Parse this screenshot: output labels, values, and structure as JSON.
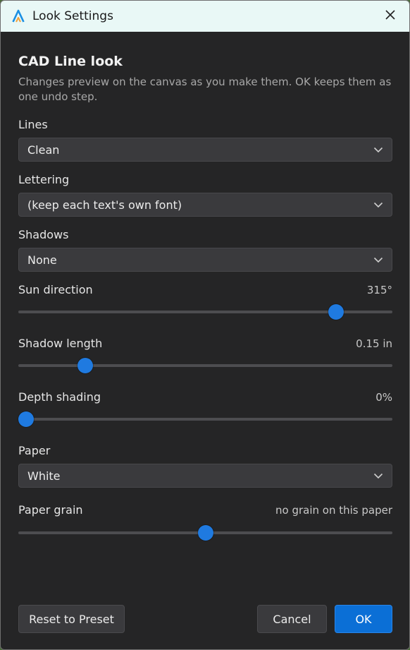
{
  "window": {
    "title": "Look Settings",
    "icons": {
      "app": "app-logo-icon",
      "close": "close-icon"
    }
  },
  "dialog": {
    "heading": "CAD Line look",
    "description": "Changes preview on the canvas as you make them. OK keeps them as one undo step."
  },
  "fields": {
    "lines": {
      "label": "Lines",
      "value": "Clean"
    },
    "lettering": {
      "label": "Lettering",
      "value": "(keep each text's own font)"
    },
    "shadows": {
      "label": "Shadows",
      "value": "None"
    },
    "sun_direction": {
      "label": "Sun direction",
      "value_text": "315°",
      "level": 0.865
    },
    "shadow_length": {
      "label": "Shadow length",
      "value_text": "0.15 in",
      "level": 0.165
    },
    "depth_shading": {
      "label": "Depth shading",
      "value_text": "0%",
      "level": 0.0
    },
    "paper": {
      "label": "Paper",
      "value": "White"
    },
    "paper_grain": {
      "label": "Paper grain",
      "value_text": "no grain on this paper",
      "level": 0.5
    }
  },
  "buttons": {
    "reset": "Reset to Preset",
    "cancel": "Cancel",
    "ok": "OK"
  },
  "colors": {
    "accent": "#0b6fd6",
    "slider_thumb": "#1f7ae0",
    "title_bar": "#e9f8f6",
    "dialog_background": "#252526"
  }
}
